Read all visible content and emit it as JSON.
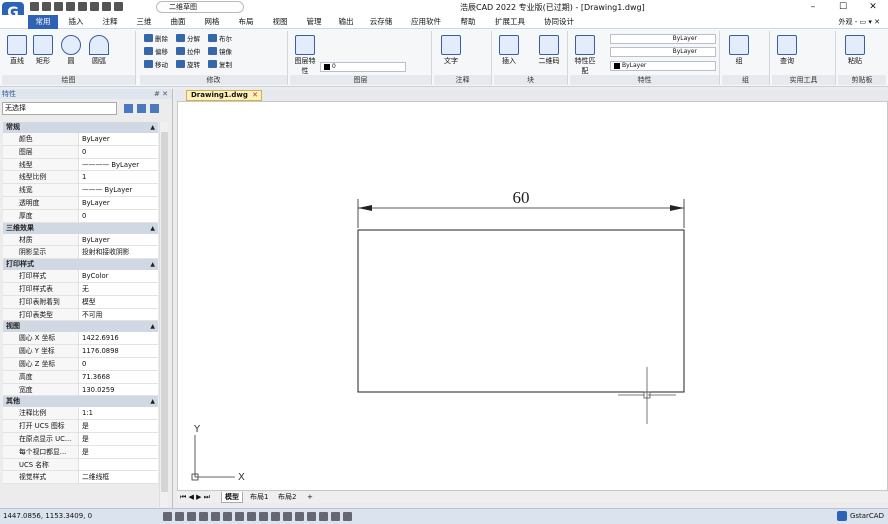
{
  "title_bar": {
    "logo_glyph": "G",
    "workspace": "二维草图",
    "window_title": "浩辰CAD 2022 专业版(已过期) - [Drawing1.dwg]",
    "controls": [
      "–",
      "☐",
      "✕"
    ]
  },
  "menu": {
    "tabs": [
      "常用",
      "插入",
      "注释",
      "三维",
      "曲面",
      "网格",
      "布局",
      "视图",
      "管理",
      "输出",
      "云存储",
      "应用软件",
      "帮助",
      "扩展工具",
      "协同设计"
    ],
    "active": "常用",
    "right_label": "外观 -",
    "right_icons": "▭ ▾ ✕"
  },
  "ribbon": {
    "draw": {
      "label": "绘图",
      "tools": [
        "直线",
        "矩形",
        "圆",
        "圆弧"
      ]
    },
    "modify": {
      "label": "修改",
      "tools": [
        "删除",
        "分解",
        "布尔",
        "偏移",
        "拉伸",
        "镜像",
        "移动",
        "旋转",
        "复制"
      ]
    },
    "layer": {
      "label": "图层",
      "tools": [
        "图层特性"
      ],
      "current_layer": "0"
    },
    "annotation": {
      "label": "注释",
      "tools": [
        "文字"
      ]
    },
    "block": {
      "label": "块",
      "tools": [
        "插入",
        "二维码"
      ]
    },
    "properties": {
      "label": "特性",
      "tools": [
        "特性匹配"
      ],
      "linetype": "ByLayer",
      "lineweight": "ByLayer",
      "color": "ByLayer"
    },
    "group": {
      "label": "组",
      "tools": [
        "组"
      ]
    },
    "utilities": {
      "label": "实用工具",
      "tools": [
        "查询"
      ]
    },
    "clipboard": {
      "label": "剪贴板",
      "tools": [
        "粘贴"
      ]
    }
  },
  "properties_panel": {
    "header": "特性",
    "header_icons": "# ✕",
    "selection": "无选择",
    "sections": [
      {
        "title": "常规",
        "rows": [
          {
            "k": "颜色",
            "v": "ByLayer"
          },
          {
            "k": "图层",
            "v": "0"
          },
          {
            "k": "线型",
            "v": "———— ByLayer"
          },
          {
            "k": "线型比例",
            "v": "1"
          },
          {
            "k": "线宽",
            "v": "——— ByLayer"
          },
          {
            "k": "透明度",
            "v": "ByLayer"
          },
          {
            "k": "厚度",
            "v": "0"
          }
        ]
      },
      {
        "title": "三维效果",
        "rows": [
          {
            "k": "材质",
            "v": "ByLayer"
          },
          {
            "k": "阴影显示",
            "v": "投射和接收阴影"
          }
        ]
      },
      {
        "title": "打印样式",
        "rows": [
          {
            "k": "打印样式",
            "v": "ByColor"
          },
          {
            "k": "打印样式表",
            "v": "无"
          },
          {
            "k": "打印表附着到",
            "v": "模型"
          },
          {
            "k": "打印表类型",
            "v": "不可用"
          }
        ]
      },
      {
        "title": "视图",
        "rows": [
          {
            "k": "圆心 X 坐标",
            "v": "1422.6916"
          },
          {
            "k": "圆心 Y 坐标",
            "v": "1176.0898"
          },
          {
            "k": "圆心 Z 坐标",
            "v": "0"
          },
          {
            "k": "高度",
            "v": "71.3668"
          },
          {
            "k": "宽度",
            "v": "130.0259"
          }
        ]
      },
      {
        "title": "其他",
        "rows": [
          {
            "k": "注释比例",
            "v": "1:1"
          },
          {
            "k": "打开 UCS 图标",
            "v": "是"
          },
          {
            "k": "在原点显示 UC...",
            "v": "是"
          },
          {
            "k": "每个视口都显...",
            "v": "是"
          },
          {
            "k": "UCS 名称",
            "v": ""
          },
          {
            "k": "视觉样式",
            "v": "二维线框"
          }
        ]
      }
    ]
  },
  "document": {
    "tab": "Drawing1.dwg",
    "tab_close": "✕",
    "dimension_text": "60"
  },
  "ucs": {
    "y_label": "Y",
    "x_label": "X"
  },
  "layout_tabs": {
    "nav": "⏮ ◀ ▶ ⏭",
    "tabs": [
      "模型",
      "布局1",
      "布局2"
    ],
    "add": "+",
    "active": "模型"
  },
  "status": {
    "coords": "1447.0856, 1153.3409, 0",
    "brand": "GstarCAD"
  }
}
